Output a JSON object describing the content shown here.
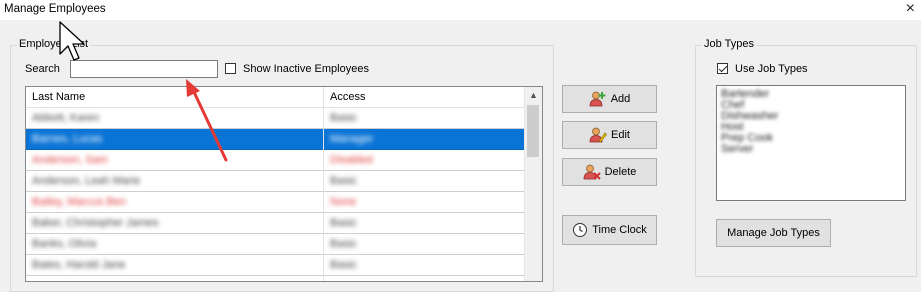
{
  "window": {
    "title": "Manage Employees",
    "close_glyph": "×"
  },
  "employee_list": {
    "group_title": "Employee List",
    "search_label": "Search",
    "search_value": "",
    "show_inactive_label": "Show Inactive Employees",
    "show_inactive_checked": false,
    "columns": [
      "Last Name",
      "Access"
    ],
    "rows": [
      {
        "name": "Abbott, Karen",
        "access": "Basic",
        "red": false,
        "selected": false
      },
      {
        "name": "Barnes, Lucas",
        "access": "Manager",
        "red": false,
        "selected": true
      },
      {
        "name": "Anderson, Sam",
        "access": "Disabled",
        "red": true,
        "selected": false
      },
      {
        "name": "Anderson, Leah Marie",
        "access": "Basic",
        "red": false,
        "selected": false
      },
      {
        "name": "Bailey, Marcus Ben",
        "access": "None",
        "red": true,
        "selected": false
      },
      {
        "name": "Baker, Christopher James",
        "access": "Basic",
        "red": false,
        "selected": false
      },
      {
        "name": "Banks, Olivia",
        "access": "Basic",
        "red": false,
        "selected": false
      },
      {
        "name": "Bates, Harold Jane",
        "access": "Basic",
        "red": false,
        "selected": false
      }
    ]
  },
  "actions": {
    "add_label": "Add",
    "edit_label": "Edit",
    "delete_label": "Delete",
    "time_clock_label": "Time Clock"
  },
  "job_types": {
    "group_title": "Job Types",
    "use_job_types_label": "Use Job Types",
    "use_job_types_checked": true,
    "items": [
      "Bartender",
      "Chef",
      "Dishwasher",
      "Host",
      "Prep Cook",
      "Server"
    ],
    "manage_button_label": "Manage Job Types"
  },
  "colors": {
    "selection": "#0a74d6",
    "inactive_text": "#e13b3b",
    "annotation_arrow": "#e53935"
  }
}
